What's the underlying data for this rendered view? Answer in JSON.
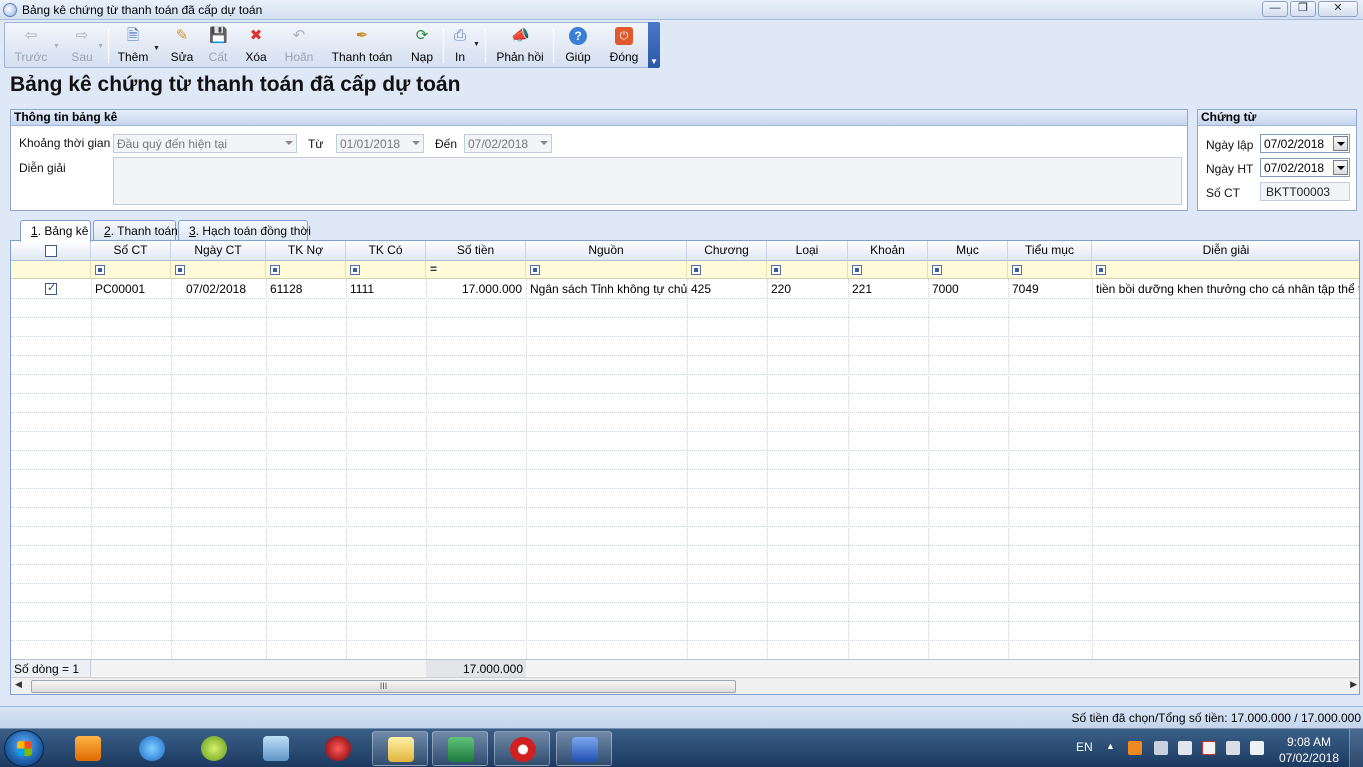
{
  "window": {
    "title": "Bảng kê chứng từ thanh toán đã cấp dự toán",
    "min": "—",
    "max": "❐",
    "close": "✕"
  },
  "toolbar": {
    "prev": "Trước",
    "next": "Sau",
    "add": "Thêm",
    "edit": "Sửa",
    "save": "Cất",
    "delete": "Xóa",
    "undo": "Hoãn",
    "pay": "Thanh toán",
    "load": "Nạp",
    "print": "In",
    "feedback": "Phản hồi",
    "help": "Giúp",
    "close": "Đóng"
  },
  "page_title": "Bảng kê chứng từ thanh toán đã cấp dự toán",
  "info_panel": {
    "header": "Thông tin bảng kê",
    "period_label": "Khoảng thời gian",
    "period_value": "Đầu quý đến hiện tại",
    "from_label": "Từ",
    "from_value": "01/01/2018",
    "to_label": "Đến",
    "to_value": "07/02/2018",
    "desc_label": "Diễn giải",
    "desc_value": ""
  },
  "voucher_panel": {
    "header": "Chứng từ",
    "date_created_label": "Ngày lập",
    "date_created_value": "07/02/2018",
    "date_posted_label": "Ngày HT",
    "date_posted_value": "07/02/2018",
    "number_label": "Số CT",
    "number_value": "BKTT00003"
  },
  "tabs": [
    {
      "num": "1",
      "label": ". Bảng kê"
    },
    {
      "num": "2",
      "label": ". Thanh toán"
    },
    {
      "num": "3",
      "label": ". Hạch toán đồng thời"
    }
  ],
  "grid": {
    "columns": [
      "",
      "Số CT",
      "Ngày CT",
      "TK Nợ",
      "TK Có",
      "Số tiền",
      "Nguồn",
      "Chương",
      "Loại",
      "Khoản",
      "Mục",
      "Tiểu mục",
      "Diễn giải"
    ],
    "filter_eq": "=",
    "rows": [
      {
        "checked": true,
        "so_ct": "PC00001",
        "ngay_ct": "07/02/2018",
        "tk_no": "61128",
        "tk_co": "1111",
        "so_tien": "17.000.000",
        "nguon": "Ngân sách Tỉnh không tự chủ",
        "chuong": "425",
        "loai": "220",
        "khoan": "221",
        "muc": "7000",
        "tieu_muc": "7049",
        "dien_giai": "tiền bồi dưỡng khen thưởng cho cá nhân tập thể t..."
      }
    ],
    "footer_count": "Số dòng = 1",
    "footer_total": "17.000.000",
    "scroll_thumb": "III",
    "scroll_left": "◀",
    "scroll_right": "▶"
  },
  "status": {
    "text": "Số tiền đã chọn/Tổng số tiền: 17.000.000 / 17.000.000"
  },
  "taskbar": {
    "lang": "EN",
    "tray_arrow": "▲",
    "time": "9:08 AM",
    "date": "07/02/2018"
  },
  "colors": {
    "accent": "#4a78c8",
    "panel_border": "#8ea7cf",
    "filter_bg": "#fffbd8",
    "taskbar": "#1c3a60"
  }
}
